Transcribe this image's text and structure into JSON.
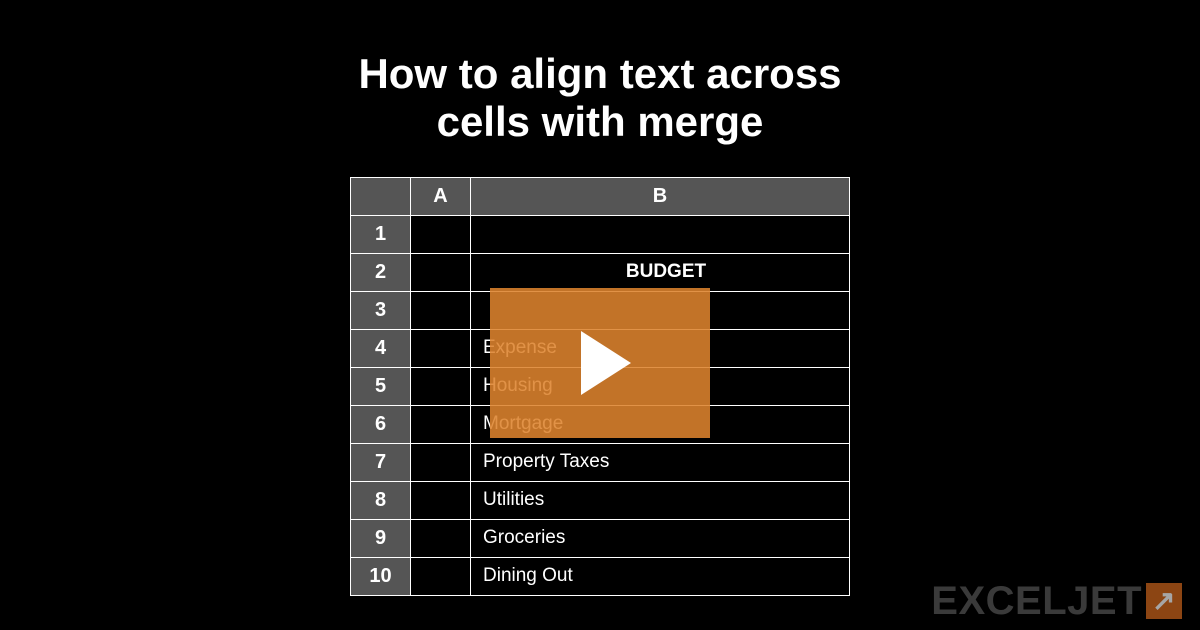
{
  "title_line1": "How to align text across",
  "title_line2": "cells with merge",
  "columns": {
    "A": "A",
    "B": "B"
  },
  "rows": {
    "r1": {
      "n": "1",
      "b": ""
    },
    "r2": {
      "n": "2",
      "b": "BUDGET"
    },
    "r3": {
      "n": "3",
      "b": ""
    },
    "r4": {
      "n": "4",
      "b": "Expense"
    },
    "r5": {
      "n": "5",
      "b": "Housing"
    },
    "r6": {
      "n": "6",
      "b": "Mortgage"
    },
    "r7": {
      "n": "7",
      "b": "Property Taxes"
    },
    "r8": {
      "n": "8",
      "b": "Utilities"
    },
    "r9": {
      "n": "9",
      "b": "Groceries"
    },
    "r10": {
      "n": "10",
      "b": "Dining Out"
    }
  },
  "watermark": "EXCELJET"
}
